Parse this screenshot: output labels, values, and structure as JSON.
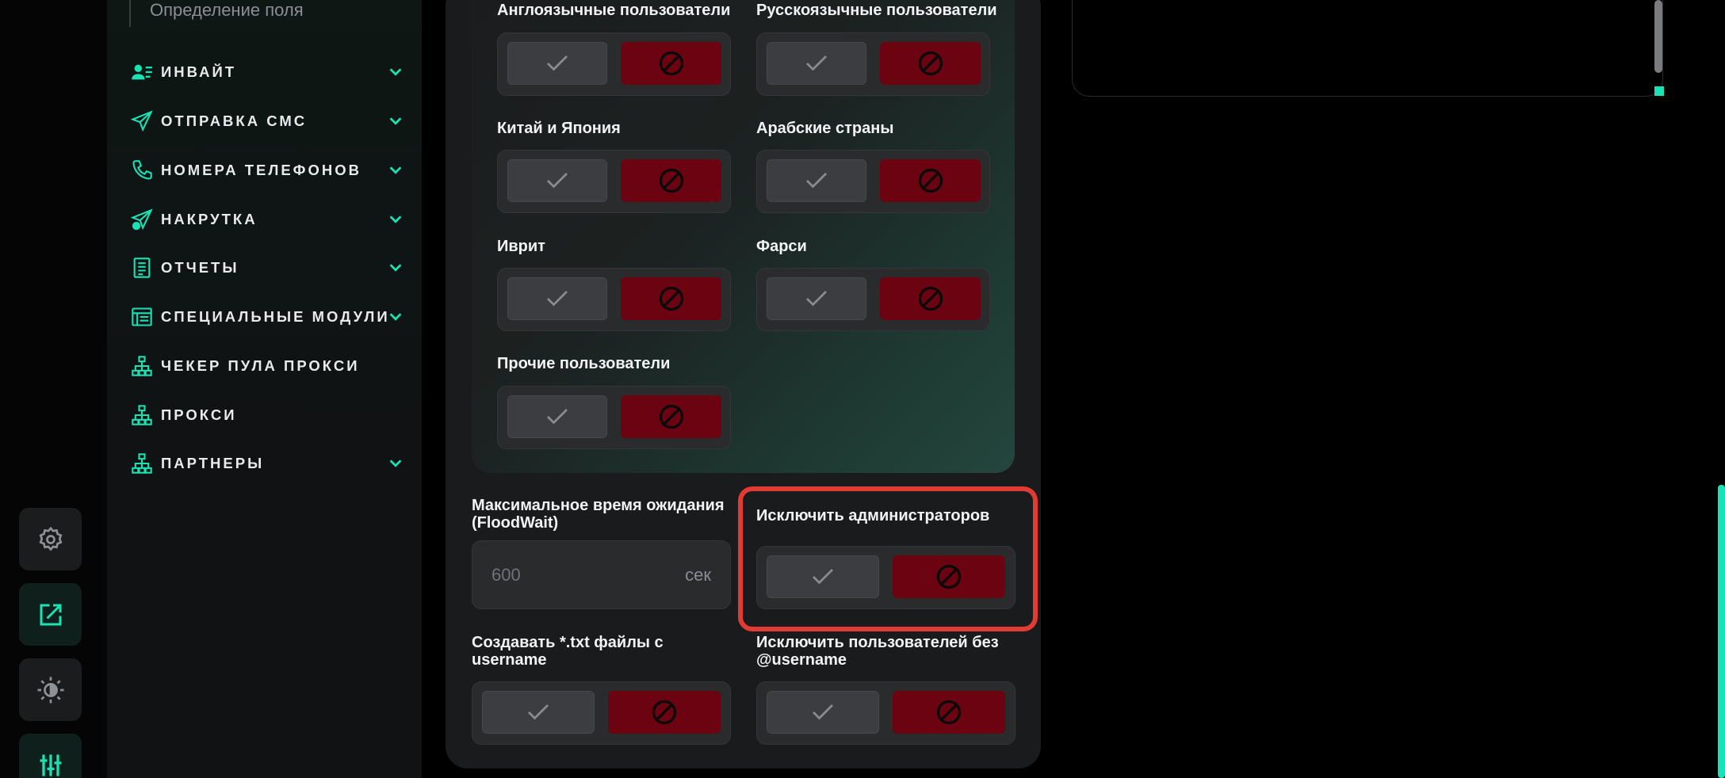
{
  "sidebar": {
    "sub_item": "Определение поля",
    "items": [
      {
        "label": "ИНВАЙТ",
        "icon": "users-list-icon",
        "has_chevron": true
      },
      {
        "label": "ОТПРАВКА СМС",
        "icon": "send-icon",
        "has_chevron": true
      },
      {
        "label": "НОМЕРА ТЕЛЕФОНОВ",
        "icon": "phone-icon",
        "has_chevron": true
      },
      {
        "label": "НАКРУТКА",
        "icon": "send-plus-icon",
        "has_chevron": true
      },
      {
        "label": "ОТЧЕТЫ",
        "icon": "document-icon",
        "has_chevron": true
      },
      {
        "label": "СПЕЦИАЛЬНЫЕ МОДУЛИ",
        "icon": "module-icon",
        "has_chevron": true
      },
      {
        "label": "ЧЕКЕР ПУЛА ПРОКСИ",
        "icon": "network-icon",
        "has_chevron": false
      },
      {
        "label": "ПРОКСИ",
        "icon": "network-icon",
        "has_chevron": false
      },
      {
        "label": "ПАРТНЕРЫ",
        "icon": "network-icon",
        "has_chevron": true
      }
    ]
  },
  "rail": [
    "settings-icon",
    "external-link-icon",
    "theme-icon",
    "sliders-icon"
  ],
  "languages": {
    "english": "Англоязычные пользователи",
    "russian": "Русскоязычные пользователи",
    "china_japan": "Китай и Япония",
    "arabic": "Арабские страны",
    "hebrew": "Иврит",
    "farsi": "Фарси",
    "other": "Прочие пользователи"
  },
  "floodwait": {
    "label": "Максимальное время ожидания (FloodWait)",
    "placeholder": "600",
    "unit": "сек"
  },
  "exclude_admins": {
    "label": "Исключить администраторов"
  },
  "create_txt": {
    "label": "Создавать *.txt файлы с username"
  },
  "exclude_no_username": {
    "label": "Исключить пользователей без @username"
  },
  "colors": {
    "accent": "#19e3b5",
    "deny": "#6b0311",
    "highlight": "#e23b34"
  }
}
